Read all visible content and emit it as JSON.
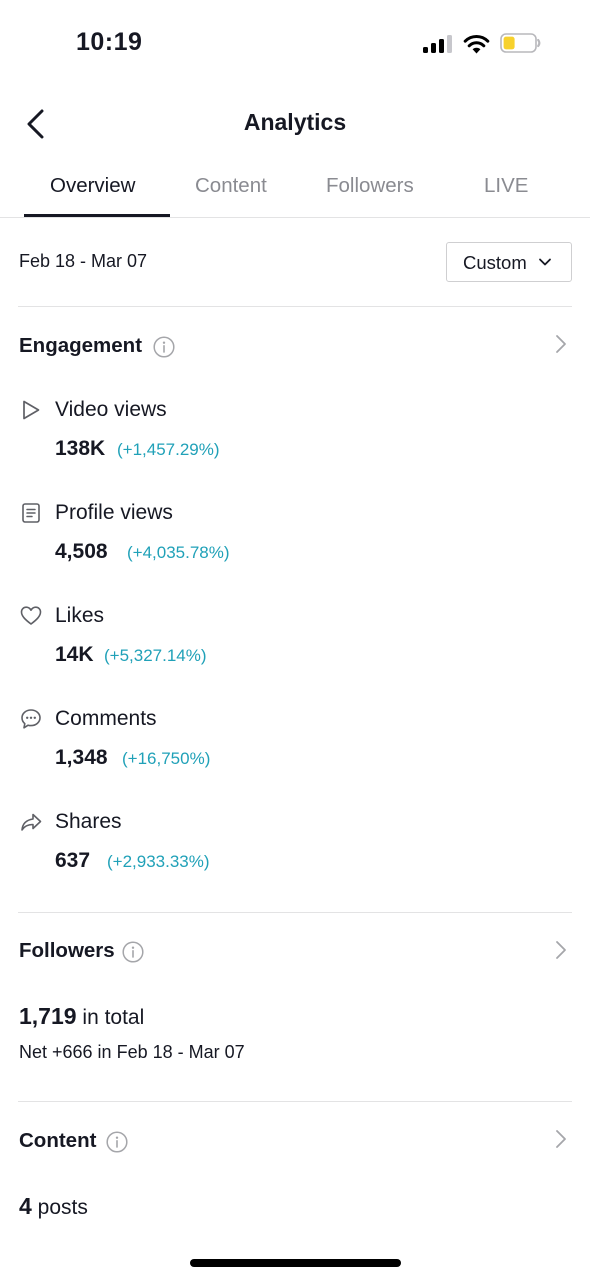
{
  "status_bar": {
    "time": "10:19",
    "battery_color": "#f7d12c"
  },
  "header": {
    "title": "Analytics"
  },
  "tabs": [
    {
      "label": "Overview",
      "active": true
    },
    {
      "label": "Content",
      "active": false
    },
    {
      "label": "Followers",
      "active": false
    },
    {
      "label": "LIVE",
      "active": false
    }
  ],
  "date_filter": {
    "range": "Feb 18 - Mar 07",
    "selected_option": "Custom"
  },
  "engagement": {
    "title": "Engagement",
    "metrics": [
      {
        "icon": "play-icon",
        "label": "Video views",
        "value": "138K",
        "change": "(+1,457.29%)"
      },
      {
        "icon": "profile-card-icon",
        "label": "Profile views",
        "value": "4,508",
        "change": "(+4,035.78%)"
      },
      {
        "icon": "heart-icon",
        "label": "Likes",
        "value": "14K",
        "change": "(+5,327.14%)"
      },
      {
        "icon": "comment-icon",
        "label": "Comments",
        "value": "1,348",
        "change": "(+16,750%)"
      },
      {
        "icon": "share-icon",
        "label": "Shares",
        "value": "637",
        "change": "(+2,933.33%)"
      }
    ]
  },
  "followers": {
    "title": "Followers",
    "total": "1,719",
    "total_suffix": "in total",
    "net": "Net +666 in Feb 18 - Mar 07"
  },
  "content": {
    "title": "Content",
    "posts_count": "4",
    "posts_suffix": "posts"
  },
  "colors": {
    "accent_change": "#20a1b8",
    "text_primary": "#161823",
    "text_secondary": "#8a8b91"
  }
}
